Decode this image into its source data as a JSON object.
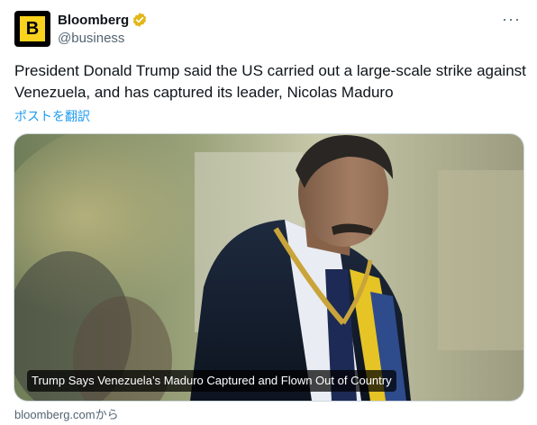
{
  "author": {
    "logo_letter": "B",
    "display_name": "Bloomberg",
    "handle": "@business"
  },
  "more_label": "···",
  "tweet": {
    "text": "President Donald Trump said the US carried out a large-scale strike against Venezuela, and has captured its leader, Nicolas Maduro",
    "translate_label": "ポストを翻訳"
  },
  "card": {
    "headline": "Trump Says Venezuela’s Maduro Captured and Flown Out of Country",
    "source": "bloomberg.comから"
  },
  "colors": {
    "brand_yellow": "#f8d21c",
    "verified_gold": "#e2b719",
    "link_blue": "#1d9bf0"
  }
}
